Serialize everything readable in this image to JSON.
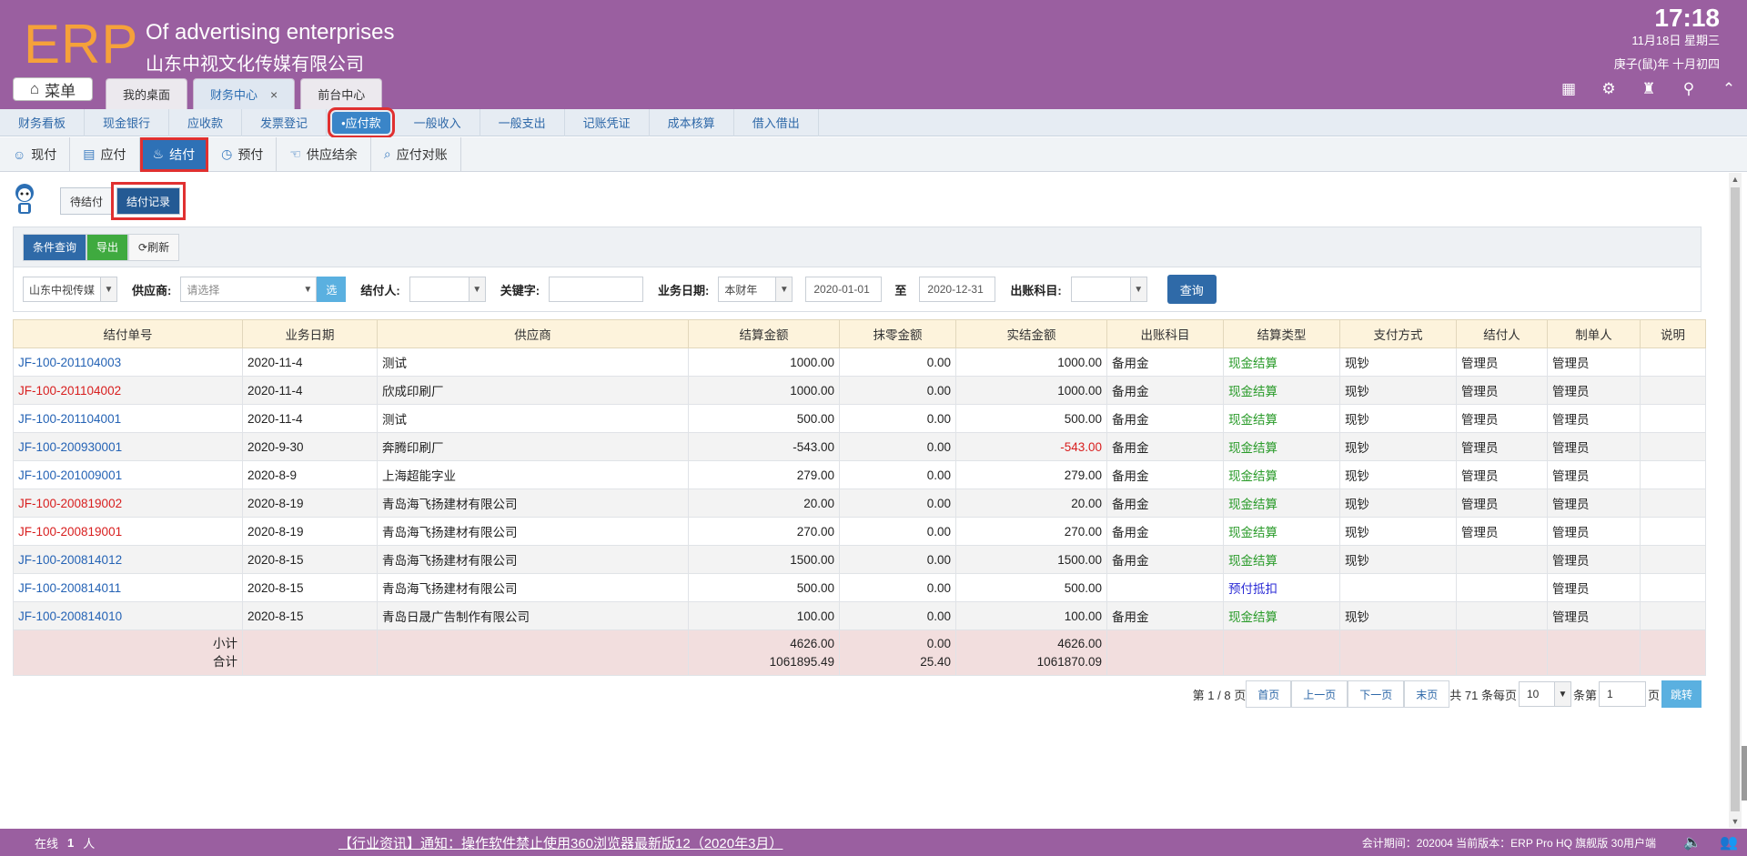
{
  "header": {
    "logo": "ERP",
    "company_en": "Of advertising enterprises",
    "company_cn": "山东中视文化传媒有限公司",
    "time": "17:18",
    "date": "11月18日 星期三",
    "lunar": "庚子(鼠)年 十月初四",
    "menu_label": "菜单",
    "tabs": [
      {
        "label": "我的桌面"
      },
      {
        "label": "财务中心",
        "close": "×"
      },
      {
        "label": "前台中心"
      }
    ]
  },
  "nav1": [
    "财务看板",
    "现金银行",
    "应收款",
    "发票登记",
    "•应付款",
    "一般收入",
    "一般支出",
    "记账凭证",
    "成本核算",
    "借入借出"
  ],
  "nav2": [
    "现付",
    "应付",
    "结付",
    "预付",
    "供应结余",
    "应付对账"
  ],
  "subtabs": [
    "待结付",
    "结付记录"
  ],
  "toolbar": {
    "query": "条件查询",
    "export": "导出",
    "refresh": "刷新"
  },
  "filters": {
    "company": "山东中视传媒",
    "supplier_label": "供应商:",
    "supplier_placeholder": "请选择",
    "pick": "选",
    "payer_label": "结付人:",
    "keyword_label": "关键字:",
    "date_label": "业务日期:",
    "period": "本财年",
    "date_from": "2020-01-01",
    "to": "至",
    "date_to": "2020-12-31",
    "account_label": "出账科目:",
    "search": "查询"
  },
  "table": {
    "headers": [
      "结付单号",
      "业务日期",
      "供应商",
      "结算金额",
      "抹零金额",
      "实结金额",
      "出账科目",
      "结算类型",
      "支付方式",
      "结付人",
      "制单人",
      "说明"
    ],
    "rows": [
      {
        "no": "JF-100-201104003",
        "no_color": "blue",
        "date": "2020-11-4",
        "supplier": "测试",
        "amount": "1000.00",
        "zero": "0.00",
        "actual": "1000.00",
        "actual_red": false,
        "account": "备用金",
        "type": "现金结算",
        "type_color": "green",
        "method": "现钞",
        "payer": "管理员",
        "maker": "管理员",
        "note": ""
      },
      {
        "no": "JF-100-201104002",
        "no_color": "red",
        "date": "2020-11-4",
        "supplier": "欣成印刷厂",
        "amount": "1000.00",
        "zero": "0.00",
        "actual": "1000.00",
        "actual_red": false,
        "account": "备用金",
        "type": "现金结算",
        "type_color": "green",
        "method": "现钞",
        "payer": "管理员",
        "maker": "管理员",
        "note": ""
      },
      {
        "no": "JF-100-201104001",
        "no_color": "blue",
        "date": "2020-11-4",
        "supplier": "测试",
        "amount": "500.00",
        "zero": "0.00",
        "actual": "500.00",
        "actual_red": false,
        "account": "备用金",
        "type": "现金结算",
        "type_color": "green",
        "method": "现钞",
        "payer": "管理员",
        "maker": "管理员",
        "note": ""
      },
      {
        "no": "JF-100-200930001",
        "no_color": "blue",
        "date": "2020-9-30",
        "supplier": "奔腾印刷厂",
        "amount": "-543.00",
        "zero": "0.00",
        "actual": "-543.00",
        "actual_red": true,
        "account": "备用金",
        "type": "现金结算",
        "type_color": "green",
        "method": "现钞",
        "payer": "管理员",
        "maker": "管理员",
        "note": ""
      },
      {
        "no": "JF-100-201009001",
        "no_color": "blue",
        "date": "2020-8-9",
        "supplier": "上海超能字业",
        "amount": "279.00",
        "zero": "0.00",
        "actual": "279.00",
        "actual_red": false,
        "account": "备用金",
        "type": "现金结算",
        "type_color": "green",
        "method": "现钞",
        "payer": "管理员",
        "maker": "管理员",
        "note": ""
      },
      {
        "no": "JF-100-200819002",
        "no_color": "red",
        "date": "2020-8-19",
        "supplier": "青岛海飞扬建材有限公司",
        "amount": "20.00",
        "zero": "0.00",
        "actual": "20.00",
        "actual_red": false,
        "account": "备用金",
        "type": "现金结算",
        "type_color": "green",
        "method": "现钞",
        "payer": "管理员",
        "maker": "管理员",
        "note": ""
      },
      {
        "no": "JF-100-200819001",
        "no_color": "red",
        "date": "2020-8-19",
        "supplier": "青岛海飞扬建材有限公司",
        "amount": "270.00",
        "zero": "0.00",
        "actual": "270.00",
        "actual_red": false,
        "account": "备用金",
        "type": "现金结算",
        "type_color": "green",
        "method": "现钞",
        "payer": "管理员",
        "maker": "管理员",
        "note": ""
      },
      {
        "no": "JF-100-200814012",
        "no_color": "blue",
        "date": "2020-8-15",
        "supplier": "青岛海飞扬建材有限公司",
        "amount": "1500.00",
        "zero": "0.00",
        "actual": "1500.00",
        "actual_red": false,
        "account": "备用金",
        "type": "现金结算",
        "type_color": "green",
        "method": "现钞",
        "payer": "",
        "maker": "管理员",
        "note": ""
      },
      {
        "no": "JF-100-200814011",
        "no_color": "blue",
        "date": "2020-8-15",
        "supplier": "青岛海飞扬建材有限公司",
        "amount": "500.00",
        "zero": "0.00",
        "actual": "500.00",
        "actual_red": false,
        "account": "",
        "type": "预付抵扣",
        "type_color": "violet",
        "method": "",
        "payer": "",
        "maker": "管理员",
        "note": ""
      },
      {
        "no": "JF-100-200814010",
        "no_color": "blue",
        "date": "2020-8-15",
        "supplier": "青岛日晟广告制作有限公司",
        "amount": "100.00",
        "zero": "0.00",
        "actual": "100.00",
        "actual_red": false,
        "account": "备用金",
        "type": "现金结算",
        "type_color": "green",
        "method": "现钞",
        "payer": "",
        "maker": "管理员",
        "note": ""
      }
    ],
    "summary": {
      "subtotal_label": "小计",
      "total_label": "合计",
      "sub_amount": "4626.00",
      "sub_zero": "0.00",
      "sub_actual": "4626.00",
      "tot_amount": "1061895.49",
      "tot_zero": "25.40",
      "tot_actual": "1061870.09"
    }
  },
  "pager": {
    "page_info": "第 1 / 8 页",
    "first": "首页",
    "prev": "上一页",
    "next": "下一页",
    "last": "末页",
    "total": "共 71 条每页",
    "per_page": "10",
    "unit": "条第",
    "page": "1",
    "page_unit": "页",
    "jump": "跳转"
  },
  "footer": {
    "online": "在线",
    "online_count": "1",
    "online_unit": "人",
    "news": "【行业资讯】通知：操作软件禁止使用360浏览器最新版12（2020年3月）",
    "period": "会计期间：202004 当前版本：ERP Pro HQ 旗舰版 30用户端"
  }
}
